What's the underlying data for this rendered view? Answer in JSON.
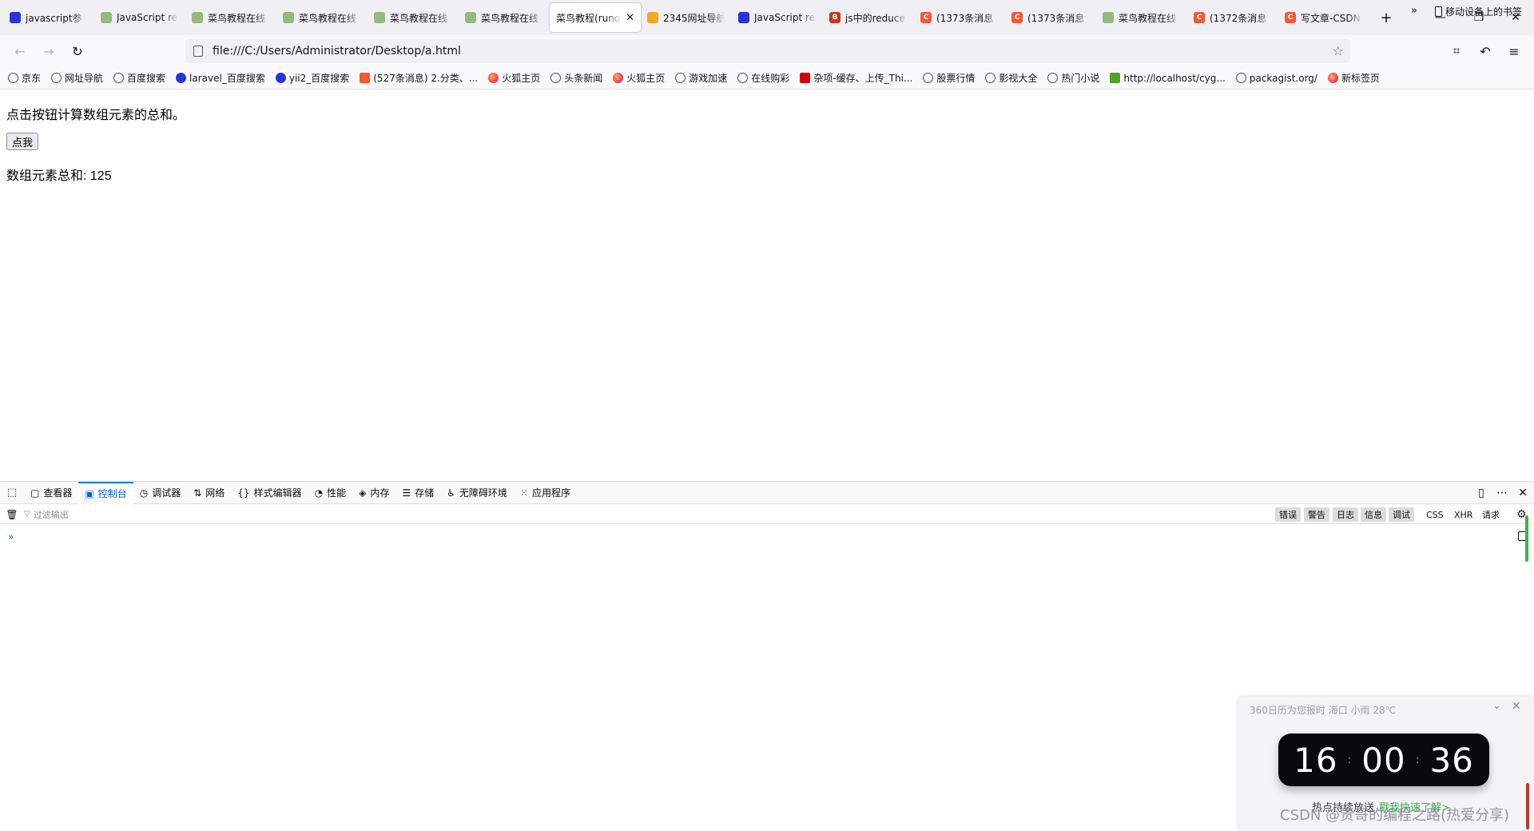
{
  "tabs": [
    {
      "title": "javascript参",
      "icon": "paw",
      "active": false
    },
    {
      "title": "JavaScript re",
      "icon": "runoob",
      "active": false
    },
    {
      "title": "菜鸟教程在线",
      "icon": "runoob",
      "active": false
    },
    {
      "title": "菜鸟教程在线",
      "icon": "runoob",
      "active": false
    },
    {
      "title": "菜鸟教程在线",
      "icon": "runoob",
      "active": false
    },
    {
      "title": "菜鸟教程在线",
      "icon": "runoob",
      "active": false
    },
    {
      "title": "菜鸟教程(runo",
      "icon": "none",
      "active": true
    },
    {
      "title": "2345网址导航",
      "icon": "2345",
      "active": false
    },
    {
      "title": "JavaScript re",
      "icon": "paw",
      "active": false
    },
    {
      "title": "js中的reduce",
      "icon": "js",
      "active": false
    },
    {
      "title": "(1373条消息",
      "icon": "csdn",
      "active": false
    },
    {
      "title": "(1373条消息",
      "icon": "csdn",
      "active": false
    },
    {
      "title": "菜鸟教程在线",
      "icon": "runoob",
      "active": false
    },
    {
      "title": "(1372条消息",
      "icon": "csdn",
      "active": false
    },
    {
      "title": "写文章-CSDN",
      "icon": "csdn",
      "active": false
    }
  ],
  "window_controls": {
    "minimize": "—",
    "restore": "❐",
    "close": "✕"
  },
  "nav": {
    "url": "file:///C:/Users/Administrator/Desktop/a.html",
    "back": "←",
    "forward": "→",
    "reload": "↻"
  },
  "bookmarks": [
    {
      "label": "京东",
      "icon": "globe"
    },
    {
      "label": "网址导航",
      "icon": "globe"
    },
    {
      "label": "百度搜索",
      "icon": "globe"
    },
    {
      "label": "laravel_百度搜索",
      "icon": "paw"
    },
    {
      "label": "yii2_百度搜索",
      "icon": "paw"
    },
    {
      "label": "(527条消息) 2.分类、...",
      "icon": "csdn"
    },
    {
      "label": "火狐主页",
      "icon": "fox"
    },
    {
      "label": "头条新闻",
      "icon": "globe"
    },
    {
      "label": "火狐主页",
      "icon": "fox"
    },
    {
      "label": "游戏加速",
      "icon": "globe"
    },
    {
      "label": "在线购彩",
      "icon": "globe"
    },
    {
      "label": "杂项-缓存、上传_Thi...",
      "icon": "s51"
    },
    {
      "label": "股票行情",
      "icon": "globe"
    },
    {
      "label": "影视大全",
      "icon": "globe"
    },
    {
      "label": "热门小说",
      "icon": "globe"
    },
    {
      "label": "http://localhost/cyg...",
      "icon": "cyg"
    },
    {
      "label": "packagist.org/",
      "icon": "globe"
    },
    {
      "label": "新标签页",
      "icon": "fox"
    }
  ],
  "bookmarks_more": "»",
  "bookmarks_mobile": "移动设备上的书签",
  "page": {
    "intro": "点击按钮计算数组元素的总和。",
    "button_label": "点我",
    "result": "数组元素总和: 125"
  },
  "devtools": {
    "tabs": [
      {
        "label": "查看器",
        "icon": "▢",
        "active": false
      },
      {
        "label": "控制台",
        "icon": "▣",
        "active": true
      },
      {
        "label": "调试器",
        "icon": "◷",
        "active": false
      },
      {
        "label": "网络",
        "icon": "⇅",
        "active": false
      },
      {
        "label": "样式编辑器",
        "icon": "{}",
        "active": false
      },
      {
        "label": "性能",
        "icon": "◔",
        "active": false
      },
      {
        "label": "内存",
        "icon": "◈",
        "active": false
      },
      {
        "label": "存储",
        "icon": "☰",
        "active": false
      },
      {
        "label": "无障碍环境",
        "icon": "♿",
        "active": false
      },
      {
        "label": "应用程序",
        "icon": "⁙",
        "active": false
      }
    ],
    "filter_placeholder": "过滤输出",
    "levels": [
      {
        "label": "错误",
        "on": true
      },
      {
        "label": "警告",
        "on": true
      },
      {
        "label": "日志",
        "on": true
      },
      {
        "label": "信息",
        "on": true
      },
      {
        "label": "调试",
        "on": true
      },
      {
        "label": "CSS",
        "on": false
      },
      {
        "label": "XHR",
        "on": false
      },
      {
        "label": "请求",
        "on": false
      }
    ],
    "prompt": "»"
  },
  "widget": {
    "title": "360日历为您报时 海口 小雨 28℃",
    "hours": "16",
    "minutes": "00",
    "seconds": "36",
    "news_prefix": "热点持续放送",
    "news_link": "戳我快速了解>"
  },
  "watermark": "CSDN @贵哥的编程之路(热爱分享)",
  "colors": {
    "accent": "#0060df",
    "tab_strip": "#f0f0f4",
    "widget_link": "#2fb34a"
  }
}
